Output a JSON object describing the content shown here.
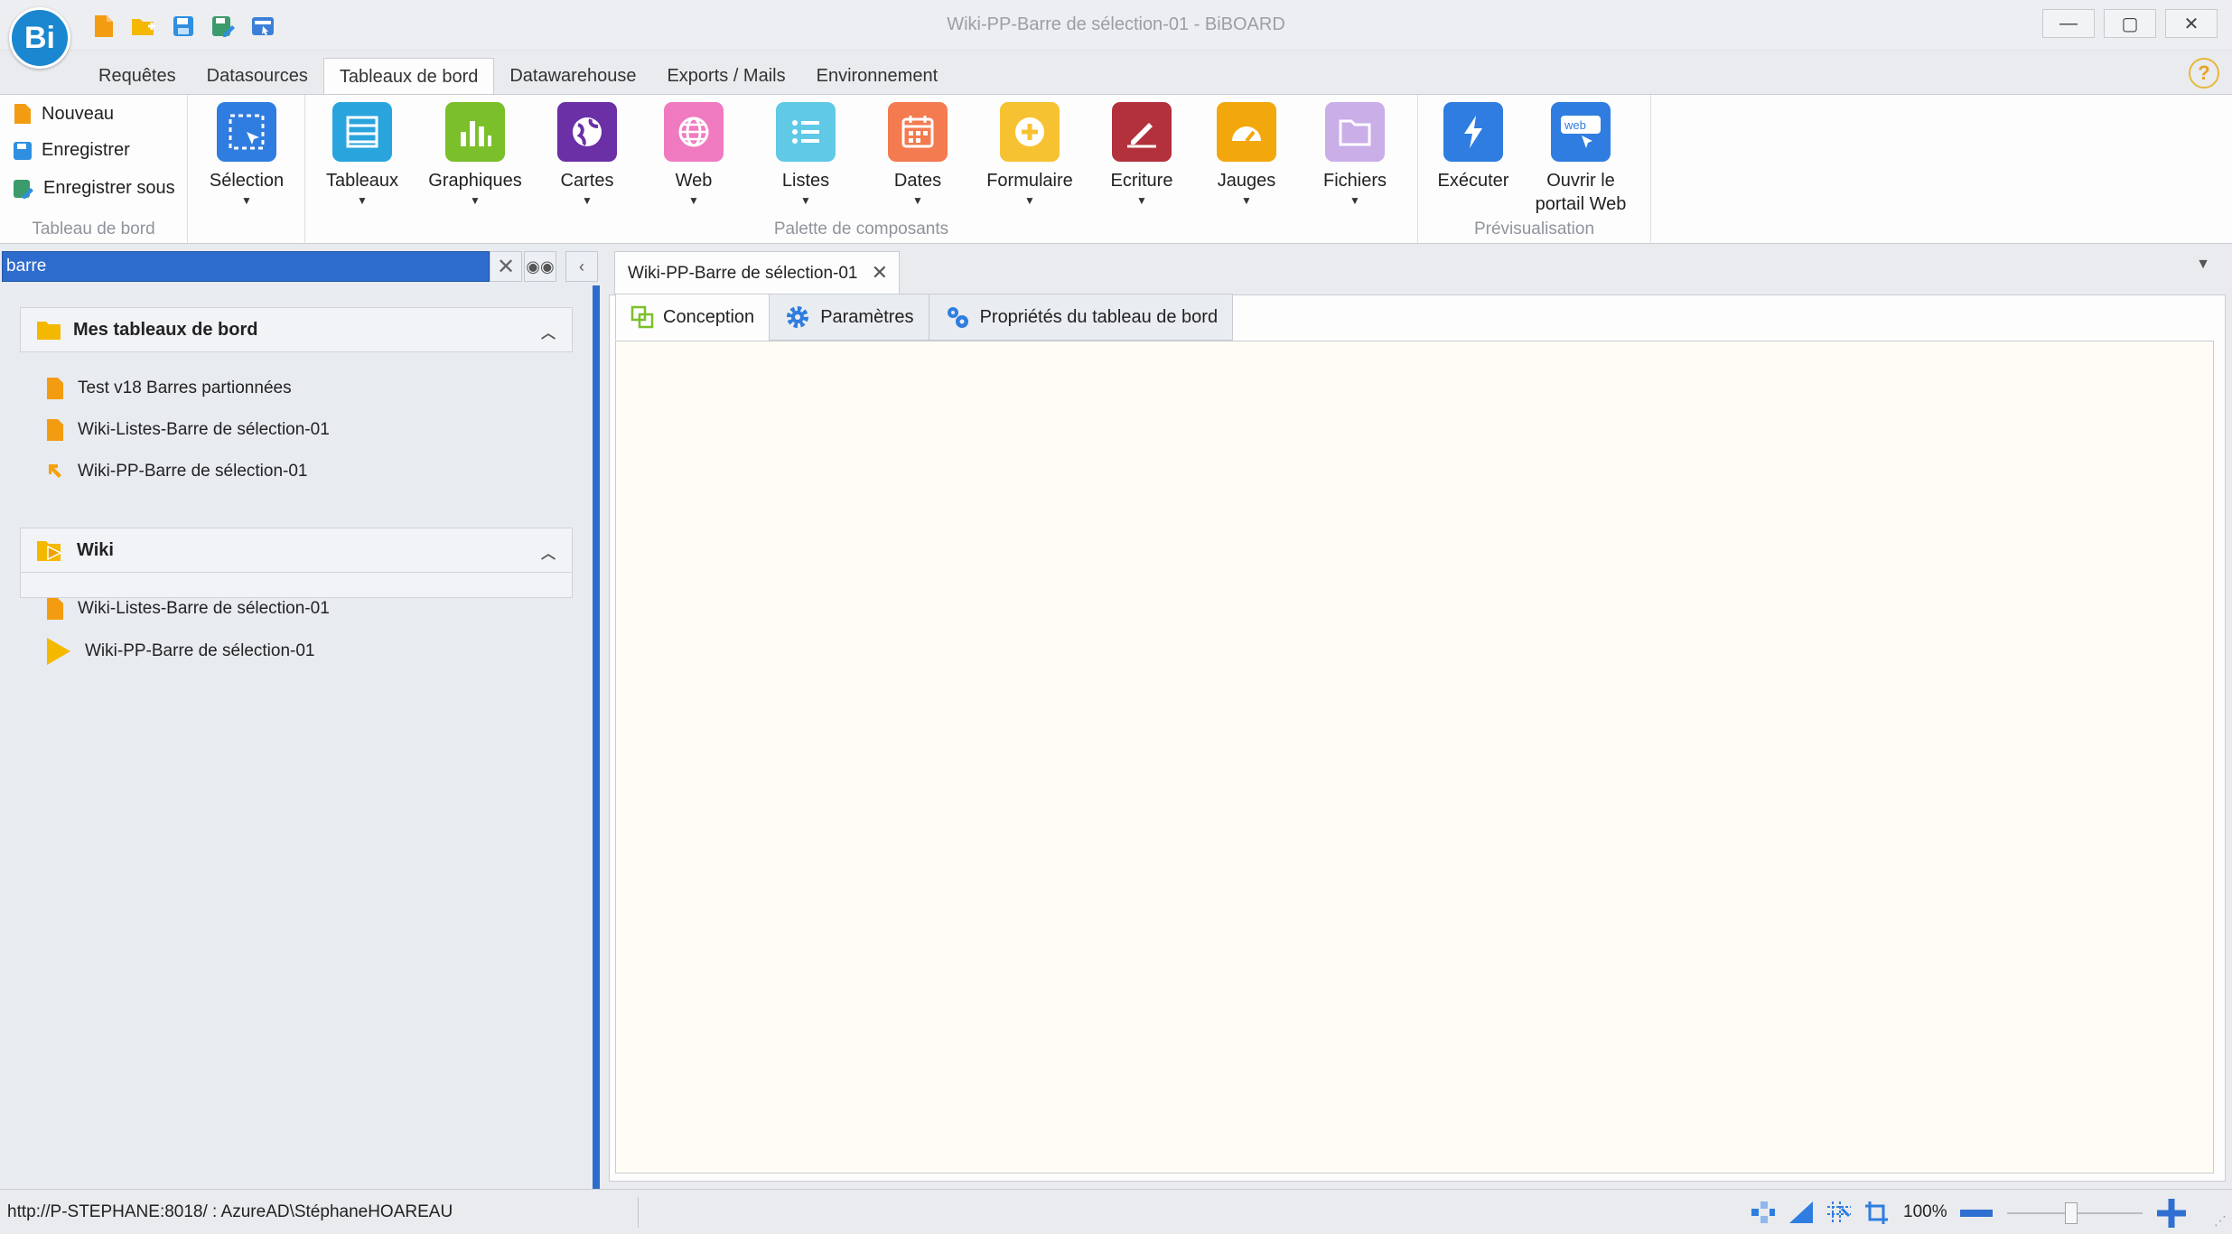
{
  "window": {
    "title": "Wiki-PP-Barre de sélection-01 - BiBOARD",
    "logo_text": "Bi"
  },
  "quick_access": [
    {
      "icon": "new-file-icon",
      "color": "#f39c12"
    },
    {
      "icon": "new-folder-icon",
      "color": "#f5b800"
    },
    {
      "icon": "save-icon",
      "color": "#2f8fe0"
    },
    {
      "icon": "save-as-icon",
      "color": "#3c9b6a"
    },
    {
      "icon": "preview-icon",
      "color": "#3d7fd8"
    }
  ],
  "ribbon_tabs": [
    {
      "label": "Requêtes",
      "active": false
    },
    {
      "label": "Datasources",
      "active": false
    },
    {
      "label": "Tableaux de bord",
      "active": true
    },
    {
      "label": "Datawarehouse",
      "active": false
    },
    {
      "label": "Exports / Mails",
      "active": false
    },
    {
      "label": "Environnement",
      "active": false
    }
  ],
  "ribbon": {
    "dashboard_group": {
      "label": "Tableau de bord",
      "new": "Nouveau",
      "save": "Enregistrer",
      "save_as": "Enregistrer sous"
    },
    "selection": {
      "label": "Sélection",
      "color": "#2f7de0"
    },
    "palette_group": {
      "label": "Palette de composants"
    },
    "components": [
      {
        "label": "Tableaux",
        "color": "#29a4dd"
      },
      {
        "label": "Graphiques",
        "color": "#7bbf2a"
      },
      {
        "label": "Cartes",
        "color": "#6b2fa6"
      },
      {
        "label": "Web",
        "color": "#f07ac0"
      },
      {
        "label": "Listes",
        "color": "#5fc9e6"
      },
      {
        "label": "Dates",
        "color": "#f47a4f"
      },
      {
        "label": "Formulaire",
        "color": "#f7c232"
      },
      {
        "label": "Ecriture",
        "color": "#b3313d"
      },
      {
        "label": "Jauges",
        "color": "#f2a70c"
      },
      {
        "label": "Fichiers",
        "color": "#c9aee8"
      }
    ],
    "preview_group": {
      "label": "Prévisualisation",
      "execute": "Exécuter",
      "open_portal_line1": "Ouvrir le",
      "open_portal_line2": "portail Web",
      "web_badge": "web"
    }
  },
  "search": {
    "value": "barre"
  },
  "tree": {
    "my_dashboards": {
      "title": "Mes tableaux de bord",
      "items": [
        {
          "label": "Test v18 Barres partionnées",
          "icon": "dashboard-file-icon"
        },
        {
          "label": "Wiki-Listes-Barre de sélection-01",
          "icon": "dashboard-file-icon"
        },
        {
          "label": "Wiki-PP-Barre de sélection-01",
          "icon": "shortcut-arrow-icon"
        }
      ]
    },
    "wiki": {
      "title": "Wiki",
      "items": [
        {
          "label": "Wiki-Listes-Barre de sélection-01",
          "icon": "dashboard-file-icon"
        },
        {
          "label": "Wiki-PP-Barre de sélection-01",
          "icon": "play-icon"
        }
      ]
    }
  },
  "document": {
    "tab_title": "Wiki-PP-Barre de sélection-01",
    "sub_tabs": [
      {
        "label": "Conception",
        "active": true,
        "icon": "design-icon"
      },
      {
        "label": "Paramètres",
        "active": false,
        "icon": "gear-icon"
      },
      {
        "label": "Propriétés du tableau de bord",
        "active": false,
        "icon": "gears-icon"
      }
    ]
  },
  "status": {
    "connection": "http://P-STEPHANE:8018/ : AzureAD\\StéphaneHOAREAU",
    "zoom": "100%"
  }
}
